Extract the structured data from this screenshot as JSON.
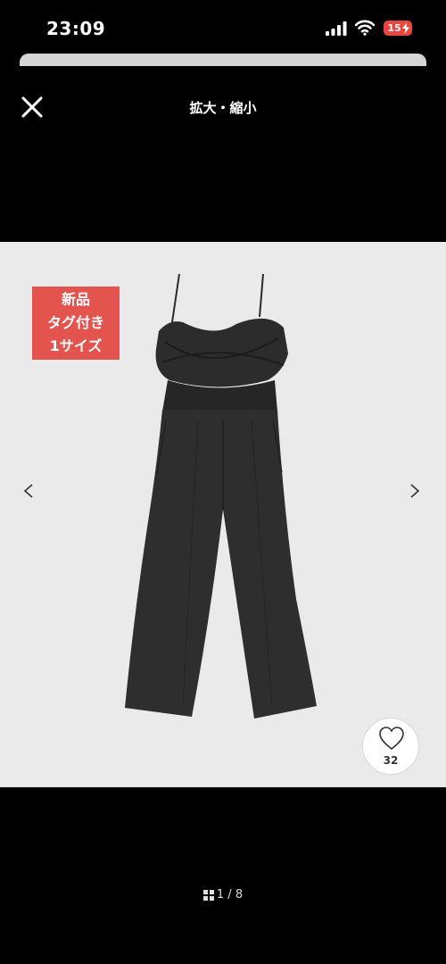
{
  "status_bar": {
    "time": "23:09",
    "battery_level": "15",
    "icons": [
      "signal-icon",
      "wifi-icon",
      "battery-icon",
      "charging-bolt-icon"
    ],
    "battery_color": "#e8463f"
  },
  "header": {
    "title": "拡大・縮小",
    "close_icon": "close-icon"
  },
  "image": {
    "badge_lines": [
      "新品",
      "タグ付き",
      "1サイズ"
    ],
    "badge_color": "#e2544d",
    "prev_icon": "chevron-left-icon",
    "next_icon": "chevron-right-icon",
    "background_color": "#eaeaea"
  },
  "like": {
    "icon": "heart-icon",
    "count": "32"
  },
  "pagination": {
    "icon": "grid-icon",
    "text": "1 / 8"
  }
}
